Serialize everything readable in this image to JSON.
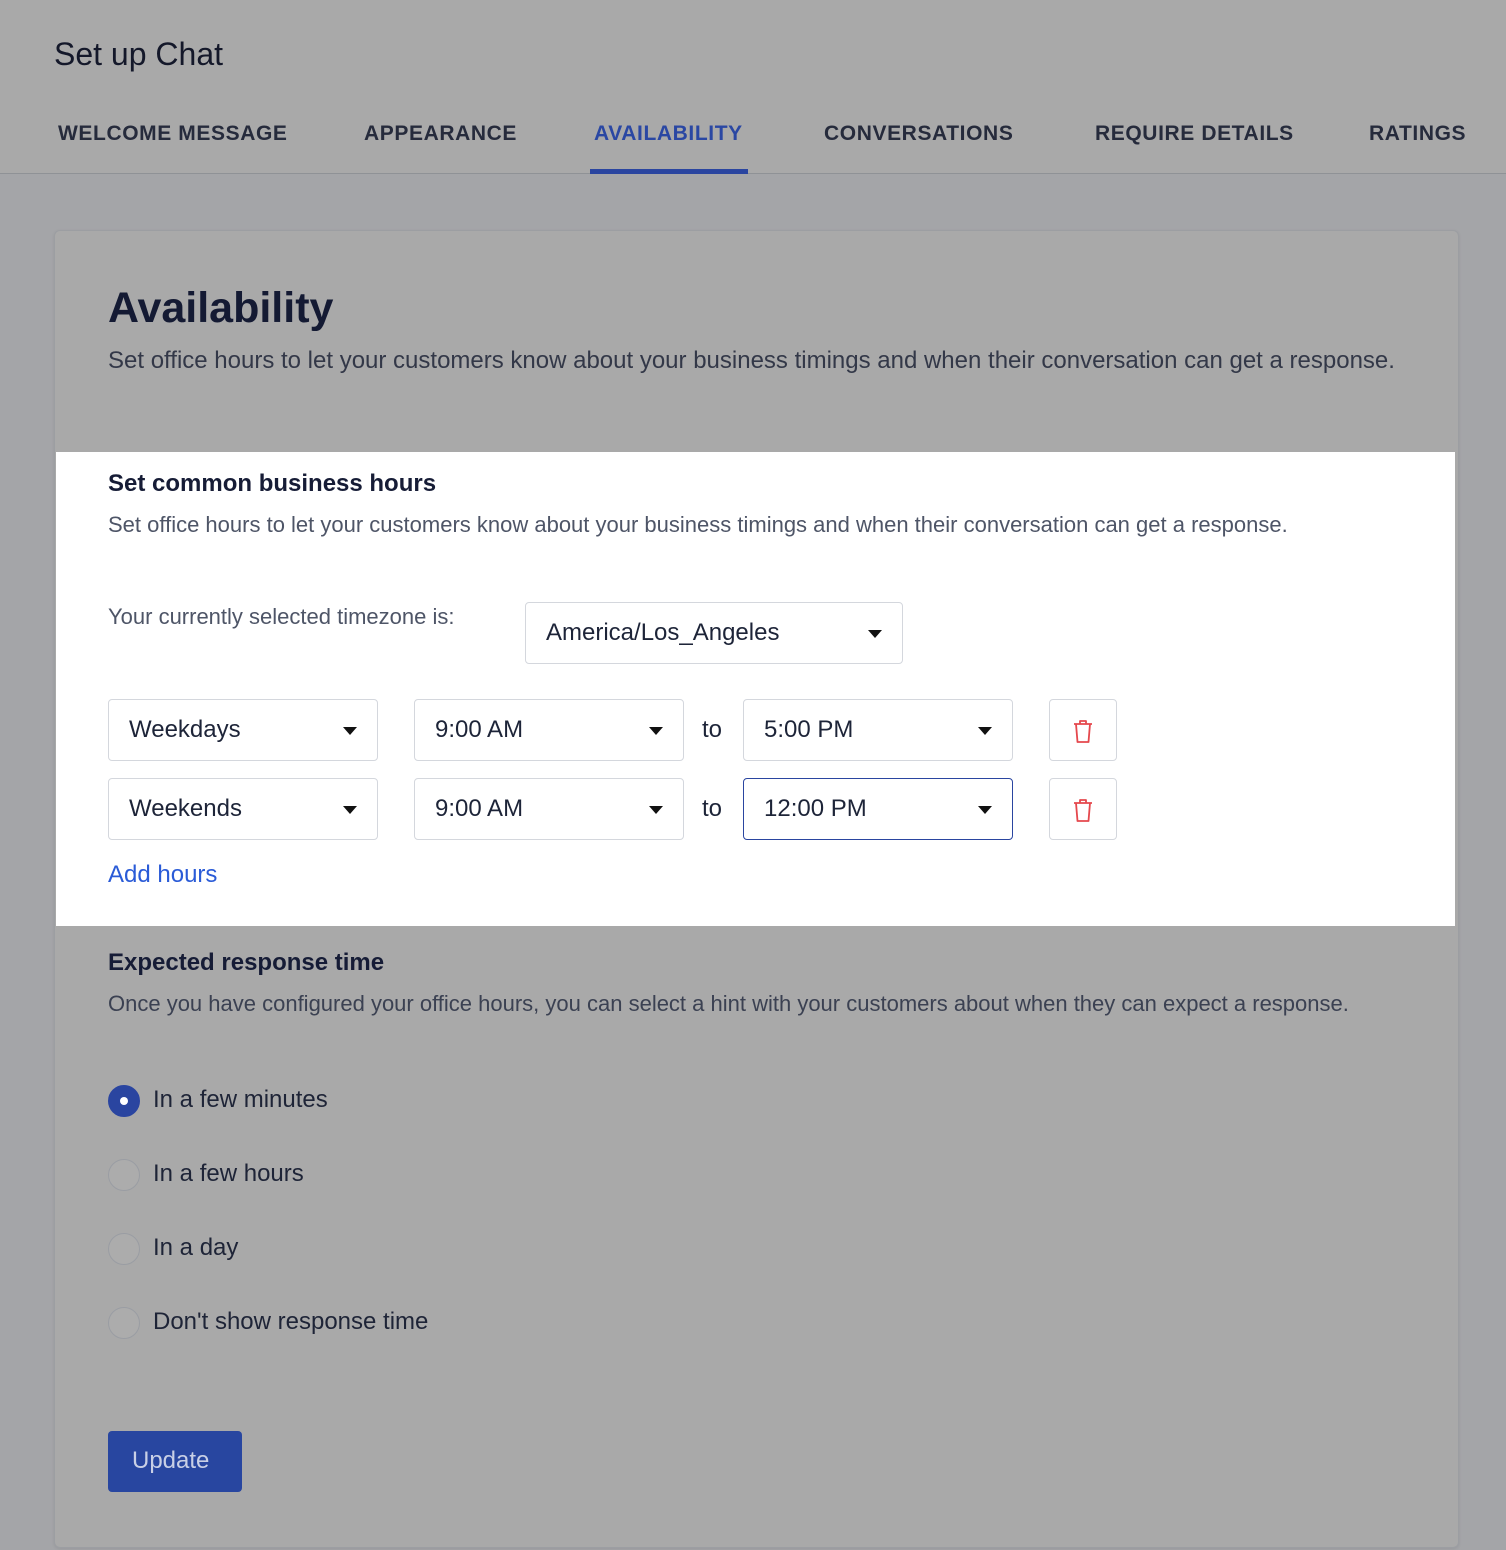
{
  "header": {
    "title": "Set up Chat",
    "tabs": [
      {
        "label": "WELCOME MESSAGE",
        "active": false
      },
      {
        "label": "APPEARANCE",
        "active": false
      },
      {
        "label": "AVAILABILITY",
        "active": true
      },
      {
        "label": "CONVERSATIONS",
        "active": false
      },
      {
        "label": "REQUIRE DETAILS",
        "active": false
      },
      {
        "label": "RATINGS",
        "active": false
      }
    ]
  },
  "availability": {
    "title": "Availability",
    "description": "Set office hours to let your customers know about your business timings and when their conversation can get a response."
  },
  "business_hours": {
    "title": "Set common business hours",
    "description": "Set office hours to let your customers know about your business timings and when their conversation can get a response.",
    "timezone_label": "Your currently selected timezone is:",
    "timezone_value": "America/Los_Angeles",
    "rows": [
      {
        "days": "Weekdays",
        "from": "9:00 AM",
        "to_label": "to",
        "to": "5:00 PM"
      },
      {
        "days": "Weekends",
        "from": "9:00 AM",
        "to_label": "to",
        "to": "12:00 PM"
      }
    ],
    "add_hours_label": "Add hours"
  },
  "response_time": {
    "title": "Expected response time",
    "description": "Once you have configured your office hours, you can select a hint with your customers about when they can expect a response.",
    "options": [
      {
        "label": "In a few minutes",
        "selected": true
      },
      {
        "label": "In a few hours",
        "selected": false
      },
      {
        "label": "In a day",
        "selected": false
      },
      {
        "label": "Don't show response time",
        "selected": false
      }
    ]
  },
  "actions": {
    "update_label": "Update"
  },
  "colors": {
    "accent": "#2a45a0",
    "link": "#2a5bd7",
    "delete_icon": "#e5484d"
  },
  "icons": [
    "caret-down-icon",
    "trash-icon",
    "radio-icon"
  ]
}
